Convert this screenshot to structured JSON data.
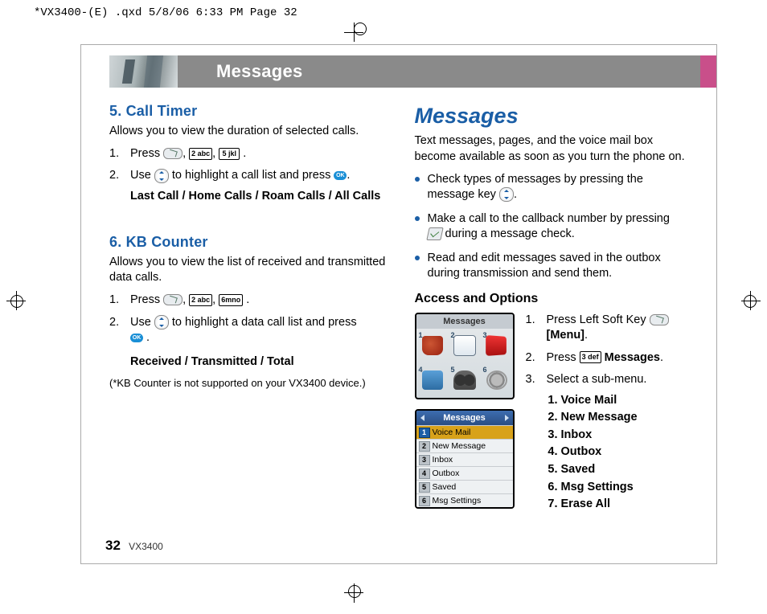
{
  "qxd_header": "*VX3400-(E) .qxd  5/8/06  6:33 PM  Page 32",
  "header_title": "Messages",
  "page_number": "32",
  "model": "VX3400",
  "left": {
    "s5": {
      "heading": "5. Call Timer",
      "intro": "Allows you to view the duration of selected calls.",
      "step1_pre": "Press ",
      "key_2": "2 abc",
      "key_5": "5 jkl",
      "step2_a": "Use ",
      "step2_b": " to highlight a call list and press ",
      "step2_c": ".",
      "options": "Last Call / Home Calls / Roam Calls / All Calls"
    },
    "s6": {
      "heading": "6. KB Counter",
      "intro": "Allows you to view the list of received and transmitted data calls.",
      "step1_pre": "Press ",
      "key_2": "2 abc",
      "key_6": "6mno",
      "step2_a": "Use ",
      "step2_b": " to highlight a data call list and press",
      "options": "Received / Transmitted / Total",
      "note": "(*KB Counter is not supported on your VX3400 device.)"
    }
  },
  "right": {
    "title": "Messages",
    "intro": "Text messages, pages, and the voice mail box become available as soon as you turn the phone on.",
    "b1a": "Check types of messages by pressing the message key ",
    "b1b": ".",
    "b2a": "Make a call to the callback number by pressing ",
    "b2b": " during a message check.",
    "b3": "Read and edit messages saved in the outbox during transmission and send them.",
    "access_heading": "Access and Options",
    "icons_title": "Messages",
    "list_title": "Messages",
    "list_items": [
      "Voice Mail",
      "New Message",
      "Inbox",
      "Outbox",
      "Saved",
      "Msg Settings"
    ],
    "steps": {
      "s1a": "Press Left Soft Key ",
      "s1b": "[Menu]",
      "s1c": ".",
      "s2a": "Press ",
      "key_3": "3 def",
      "s2b": "Messages",
      "s2c": ".",
      "s3": "Select a sub-menu.",
      "submenu": [
        "Voice Mail",
        "New Message",
        "Inbox",
        "Outbox",
        "Saved",
        "Msg Settings",
        "Erase All"
      ]
    }
  },
  "ok_label": "OK",
  "sep": ",  "
}
